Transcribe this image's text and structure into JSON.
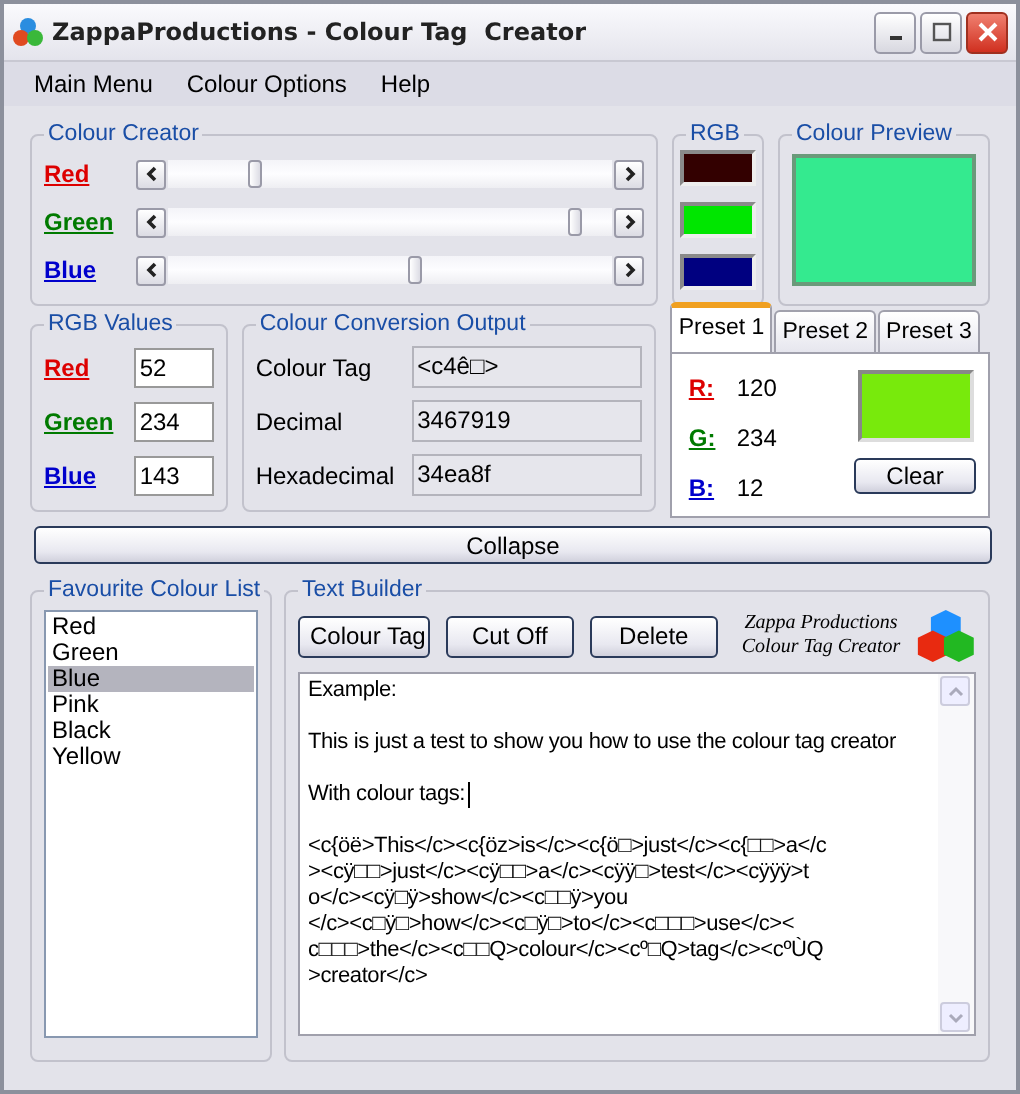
{
  "window": {
    "title": "ZappaProductions - Colour Tag  Creator"
  },
  "menu": [
    "Main Menu",
    "Colour Options",
    "Help"
  ],
  "colour_creator": {
    "title": "Colour Creator",
    "channels": [
      {
        "name": "Red",
        "color": "#dd0000",
        "level": 0.2
      },
      {
        "name": "Green",
        "color": "#007a00",
        "level": 0.92
      },
      {
        "name": "Blue",
        "color": "#0000cc",
        "level": 0.56
      }
    ]
  },
  "rgb": {
    "title": "RGB",
    "swatches": [
      {
        "color": "#330000"
      },
      {
        "color": "#00e600"
      },
      {
        "color": "#000080"
      }
    ]
  },
  "colour_preview": {
    "title": "Colour Preview",
    "color": "#34ea8f"
  },
  "rgb_values": {
    "title": "RGB Values",
    "fields": [
      {
        "label": "Red",
        "color": "#dd0000",
        "value": "52"
      },
      {
        "label": "Green",
        "color": "#007a00",
        "value": "234"
      },
      {
        "label": "Blue",
        "color": "#0000cc",
        "value": "143"
      }
    ]
  },
  "conversion": {
    "title": "Colour Conversion Output",
    "rows": [
      {
        "label": "Colour Tag",
        "value": "<c4ê□>"
      },
      {
        "label": "Decimal",
        "value": "3467919"
      },
      {
        "label": "Hexadecimal",
        "value": "34ea8f"
      }
    ]
  },
  "presets": {
    "tabs": [
      {
        "label": "Preset 1",
        "selected": true
      },
      {
        "label": "Preset 2",
        "selected": false
      },
      {
        "label": "Preset 3",
        "selected": false
      }
    ],
    "values": [
      {
        "label": "R:",
        "color": "#dd0000",
        "value": "120"
      },
      {
        "label": "G:",
        "color": "#007a00",
        "value": "234"
      },
      {
        "label": "B:",
        "color": "#0000cc",
        "value": "12"
      }
    ],
    "swatch": {
      "color": "#78ea0c"
    },
    "clear_button": "Clear"
  },
  "collapse_button": "Collapse",
  "favourites": {
    "title": "Favourite Colour List",
    "items": [
      {
        "label": "Red",
        "selected": false
      },
      {
        "label": "Green",
        "selected": false
      },
      {
        "label": "Blue",
        "selected": true
      },
      {
        "label": "Pink",
        "selected": false
      },
      {
        "label": "Black",
        "selected": false
      },
      {
        "label": "Yellow",
        "selected": false
      }
    ]
  },
  "text_builder": {
    "title": "Text Builder",
    "buttons": [
      "Colour Tag",
      "Cut Off",
      "Delete"
    ],
    "logo_lines": [
      "Zappa Productions",
      "Colour Tag Creator"
    ],
    "paragraphs": [
      {
        "lines": [
          "Example:"
        ],
        "cursor": false
      },
      {
        "lines": [
          "This is just a test to show you how to use the colour tag creator"
        ],
        "cursor": false
      },
      {
        "lines": [
          "With colour tags:"
        ],
        "cursor": true
      },
      {
        "lines": [
          "<c{öë>This</c><c{öz>is</c><c{ö□>just</c><c{□□>a</c",
          "><cÿ□□>just</c><cÿ□□>a</c><cÿÿ□>test</c><cÿÿÿ>t",
          "o</c><cÿ□ÿ>show</c><c□□ÿ>you",
          "</c><c□ÿ□>how</c><c□ÿ□>to</c><c□□□>use</c><",
          "c□□□>the</c><c□□Q>colour</c><cº□Q>tag</c><cºÙQ",
          ">creator</c>"
        ],
        "cursor": false
      }
    ]
  }
}
